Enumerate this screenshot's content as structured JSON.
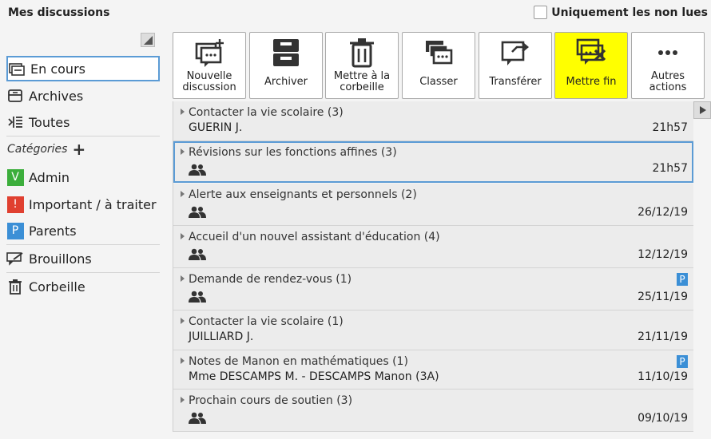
{
  "header": {
    "title": "Mes discussions",
    "unread_label": "Uniquement les non lues"
  },
  "sidebar": {
    "items": [
      {
        "label": "En cours",
        "icon": "inbox-icon"
      },
      {
        "label": "Archives",
        "icon": "archive-icon"
      },
      {
        "label": "Toutes",
        "icon": "list-icon"
      },
      {
        "label": "Admin",
        "badge": "V",
        "badge_color": "#3cae3c"
      },
      {
        "label": "Important / à traiter",
        "badge": "!",
        "badge_color": "#e04030"
      },
      {
        "label": "Parents",
        "badge": "P",
        "badge_color": "#3b8fd6"
      },
      {
        "label": "Brouillons",
        "icon": "draft-icon"
      },
      {
        "label": "Corbeille",
        "icon": "trash-icon"
      }
    ],
    "categories_label": "Catégories",
    "categories_add": "+"
  },
  "toolbar": {
    "buttons": [
      {
        "label": "Nouvelle discussion",
        "icon": "new-discussion-icon"
      },
      {
        "label": "Archiver",
        "icon": "archive-box-icon"
      },
      {
        "label": "Mettre à la corbeille",
        "icon": "trash-icon"
      },
      {
        "label": "Classer",
        "icon": "classify-icon"
      },
      {
        "label": "Transférer",
        "icon": "forward-icon"
      },
      {
        "label": "Mettre fin",
        "icon": "end-discussion-icon",
        "highlight_color": "#ffff00"
      },
      {
        "label": "Autres actions",
        "icon": "more-icon"
      }
    ]
  },
  "discussions": [
    {
      "subject": "Contacter la vie scolaire (3)",
      "participants": "GUERIN J.",
      "date": "21h57"
    },
    {
      "subject": "Révisions sur les fonctions affines (3)",
      "participants": "",
      "date": "21h57"
    },
    {
      "subject": "Alerte aux enseignants et personnels (2)",
      "participants": "",
      "date": "26/12/19"
    },
    {
      "subject": "Accueil d'un nouvel assistant d'éducation (4)",
      "participants": "",
      "date": "12/12/19"
    },
    {
      "subject": "Demande de rendez-vous (1)",
      "participants": "",
      "date": "25/11/19",
      "badge": "P"
    },
    {
      "subject": "Contacter la vie scolaire (1)",
      "participants": "JUILLIARD J.",
      "date": "21/11/19"
    },
    {
      "subject": "Notes de Manon en mathématiques (1)",
      "participants": "Mme DESCAMPS M. - DESCAMPS Manon (3A)",
      "date": "11/10/19",
      "badge": "P"
    },
    {
      "subject": "Prochain cours de soutien (3)",
      "participants": "",
      "date": "09/10/19"
    }
  ],
  "colors": {
    "accent": "#5b9bd5",
    "highlight": "#ffff00",
    "badge_parent": "#3b8fd6"
  }
}
